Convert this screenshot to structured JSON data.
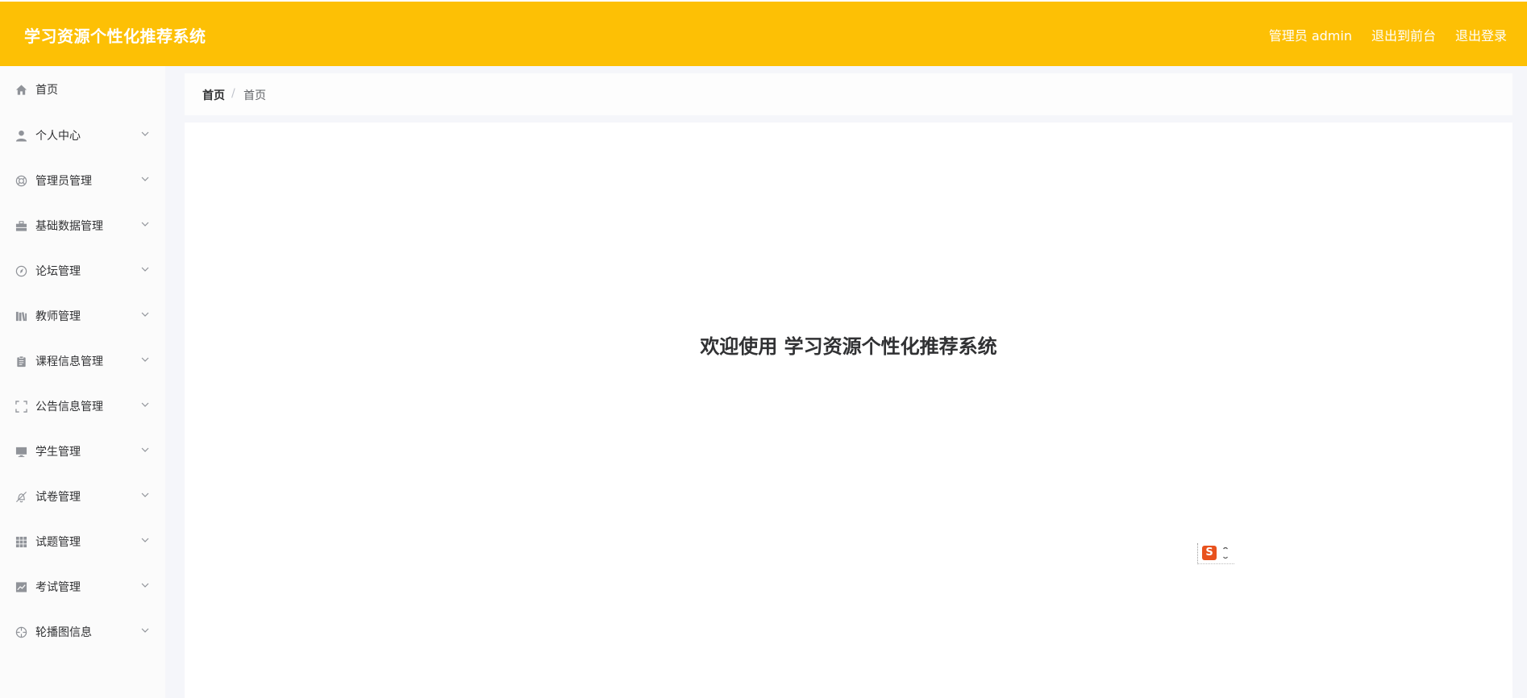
{
  "header": {
    "app_title": "学习资源个性化推荐系统",
    "background_color": "#fdc005",
    "links": [
      {
        "label": "管理员 admin",
        "icon": "user-link"
      },
      {
        "label": "退出到前台",
        "icon": "exit-frontend"
      },
      {
        "label": "退出登录",
        "icon": "logout"
      }
    ]
  },
  "sidebar": {
    "items": [
      {
        "label": "首页",
        "icon": "home-icon",
        "has_submenu": false
      },
      {
        "label": "个人中心",
        "icon": "user-icon",
        "has_submenu": true
      },
      {
        "label": "管理员管理",
        "icon": "lifebuoy-icon",
        "has_submenu": true
      },
      {
        "label": "基础数据管理",
        "icon": "briefcase-icon",
        "has_submenu": true
      },
      {
        "label": "论坛管理",
        "icon": "compass-icon",
        "has_submenu": true
      },
      {
        "label": "教师管理",
        "icon": "books-icon",
        "has_submenu": true
      },
      {
        "label": "课程信息管理",
        "icon": "clipboard-icon",
        "has_submenu": true
      },
      {
        "label": "公告信息管理",
        "icon": "fullscreen-icon",
        "has_submenu": true
      },
      {
        "label": "学生管理",
        "icon": "monitor-icon",
        "has_submenu": true
      },
      {
        "label": "试卷管理",
        "icon": "bell-off-icon",
        "has_submenu": true
      },
      {
        "label": "试题管理",
        "icon": "grid-icon",
        "has_submenu": true
      },
      {
        "label": "考试管理",
        "icon": "chart-icon",
        "has_submenu": true
      },
      {
        "label": "轮播图信息",
        "icon": "aperture-icon",
        "has_submenu": true
      }
    ]
  },
  "breadcrumb": {
    "items": [
      "首页",
      "首页"
    ],
    "separator": "/"
  },
  "main": {
    "welcome_text": "欢迎使用 学习资源个性化推荐系统"
  },
  "ime_widget": {
    "logo_letter": "S",
    "logo_color": "#e8521e"
  }
}
